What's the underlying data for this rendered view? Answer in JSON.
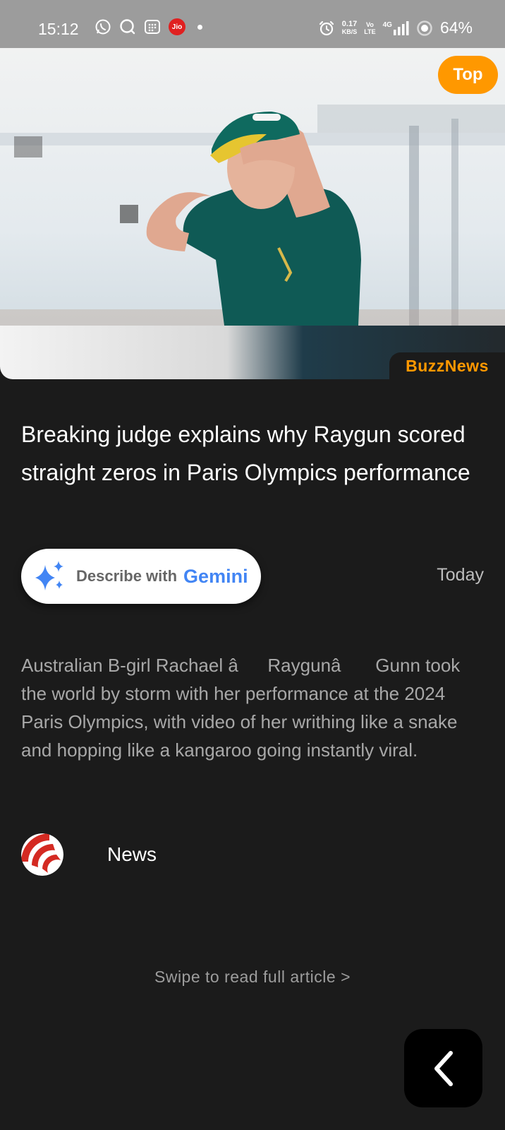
{
  "status_bar": {
    "time": "15:12",
    "net_speed_value": "0.17",
    "net_speed_unit": "KB/S",
    "volte_line1": "Vo",
    "volte_line2": "LTE",
    "network_type": "4G",
    "battery": "64%",
    "jio_label": "Jio",
    "icons_left": [
      "whatsapp-icon",
      "search-circle-icon",
      "apps-grid-icon",
      "jio-icon",
      "notification-dot"
    ],
    "icons_right": [
      "alarm-icon",
      "signal-icon",
      "battery-ring-icon"
    ]
  },
  "hero": {
    "top_button_label": "Top",
    "brand_badge": "BuzzNews",
    "accent_color": "#ff9800"
  },
  "article": {
    "headline": "Breaking judge explains why Raygun scored straight zeros in Paris Olympics performance",
    "date": "Today",
    "summary": "Australian B-girl Rachael âRaygunâ Gunn took the world by storm with her performance at the 2024 Paris Olympics, with video of her writhing like a snake and hopping like a kangaroo going instantly viral.",
    "source_name": "News",
    "swipe_hint": "Swipe to read full article >"
  },
  "gemini": {
    "prefix": "Describe with",
    "brand": "Gemini",
    "brand_color": "#4285f4"
  },
  "navigation": {
    "back_icon": "chevron-left-icon"
  }
}
